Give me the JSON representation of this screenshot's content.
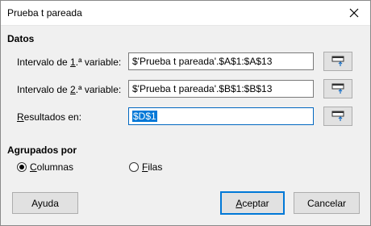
{
  "window": {
    "title": "Prueba t pareada"
  },
  "datos": {
    "heading": "Datos",
    "var1": {
      "label_pre": "Intervalo de ",
      "label_key": "1",
      "label_post": ".ª variable:",
      "value": "$'Prueba t pareada'.$A$1:$A$13"
    },
    "var2": {
      "label_pre": "Intervalo de ",
      "label_key": "2",
      "label_post": ".ª variable:",
      "value": "$'Prueba t pareada'.$B$1:$B$13"
    },
    "results": {
      "label_key": "R",
      "label_post": "esultados en:",
      "value": "$D$1"
    }
  },
  "grouping": {
    "heading": "Agrupados por",
    "columns": {
      "key": "C",
      "rest": "olumnas",
      "selected": true
    },
    "rows": {
      "key": "F",
      "rest": "ilas",
      "selected": false
    }
  },
  "buttons": {
    "help": "Ayuda",
    "ok_key": "A",
    "ok_rest": "ceptar",
    "cancel": "Cancelar"
  },
  "icons": {
    "close": "close-icon",
    "shrink": "shrink-icon"
  },
  "colors": {
    "accent": "#0078d7",
    "selection": "#0078d7"
  }
}
